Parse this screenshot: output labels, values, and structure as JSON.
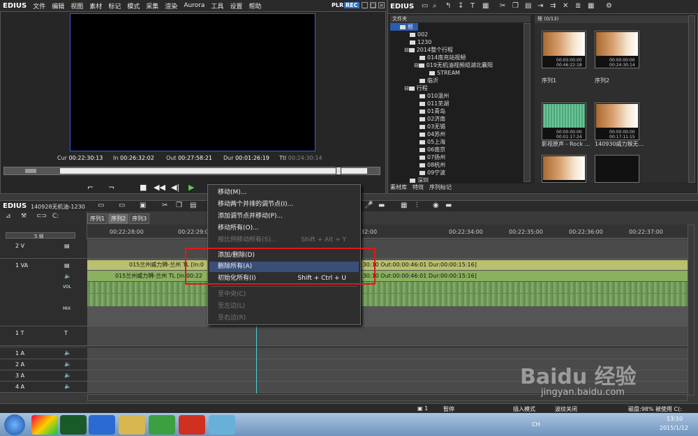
{
  "app": {
    "title": "EDIUS",
    "plr": "PLR",
    "rec": "REC"
  },
  "menubar": [
    "文件",
    "编辑",
    "视图",
    "素材",
    "标记",
    "模式",
    "采集",
    "渲染",
    "Aurora",
    "工具",
    "设置",
    "帮助"
  ],
  "player": {
    "cur_label": "Cur",
    "cur": "00:22:30:13",
    "in_label": "In",
    "in": "00:26:32:02",
    "out_label": "Out",
    "out": "00:27:58:21",
    "dur_label": "Dur",
    "dur": "00:01:26:19",
    "ttl_label": "Ttl",
    "ttl": "00:24:30:14"
  },
  "bin": {
    "title": "EDIUS",
    "folder_header": "文件夹",
    "root_label": "根",
    "clip_count": "根 (0/13)",
    "tree": [
      "根",
      "002",
      "1230",
      "2014整个行程",
      "014南充站视频",
      "019无机油视频组湖北襄阳",
      "STREAM",
      "临沂",
      "行程",
      "010温州",
      "011芜湖",
      "01青岛",
      "02济南",
      "03无锡",
      "04苏州",
      "05上海",
      "06南京",
      "07扬州",
      "08杭州",
      "09宁波",
      "深圳"
    ],
    "clips": [
      {
        "name": "序列1",
        "tc1": "00:00:00:00",
        "tc2": "00:46:22:18"
      },
      {
        "name": "序列2",
        "tc1": "00:00:00:00",
        "tc2": "00:24:30:14"
      },
      {
        "name": "影视原声 - Rock ...",
        "tc1": "00:00:00:00",
        "tc2": "00:01:17:24"
      },
      {
        "name": "140930威力猴无...",
        "tc1": "00:00:00:00",
        "tc2": "00:17:11:15"
      }
    ],
    "tabs": [
      "素材库",
      "特效",
      "序列标记"
    ]
  },
  "timeline": {
    "project": "140928无机油-1230",
    "zoom": "5 帧",
    "tabs": [
      "序列1",
      "序列2",
      "序列3"
    ],
    "ruler": [
      "00:22:28:00",
      "00:22:29:00",
      "32:00",
      "00:22:34:00",
      "00:22:35:00",
      "00:22:36:00",
      "00:22:37:00"
    ],
    "tracks": [
      "2 V",
      "1 VA",
      "1 T",
      "1 A",
      "2 A",
      "3 A",
      "4 A"
    ],
    "vol": "VOL",
    "mix": "MIX",
    "video_clip": "015兰州威力狮-兰州  TL [In:0",
    "video_clip_right": ":30:10 Out:00:00:46:01 Dur:00:00:15:16]",
    "audio_clip": "015兰州威力狮-兰州  TL [In:00:22",
    "audio_clip_right": ":30:10 Out:00:00:46:01 Dur:00:00:15:16]"
  },
  "context_menu": [
    {
      "label": "移动(M)...",
      "shortcut": "",
      "disabled": false
    },
    {
      "label": "移动两个并排的调节点(I)...",
      "shortcut": "",
      "disabled": false
    },
    {
      "label": "添加调节点并移动(P)...",
      "shortcut": "",
      "disabled": false
    },
    {
      "label": "移动所有(O)...",
      "shortcut": "",
      "disabled": false
    },
    {
      "label": "按比例移动所有(S)...",
      "shortcut": "Shift + Alt + Y",
      "disabled": true
    },
    {
      "label": "添加/删除(D)",
      "shortcut": "",
      "disabled": false
    },
    {
      "label": "删除所有(A)",
      "shortcut": "",
      "disabled": false
    },
    {
      "label": "初始化所有(I)",
      "shortcut": "Shift + Ctrl + U",
      "disabled": false
    },
    {
      "label": "至中央(C)",
      "shortcut": "",
      "disabled": true
    },
    {
      "label": "至左边(L)",
      "shortcut": "",
      "disabled": true
    },
    {
      "label": "至右边(R)",
      "shortcut": "",
      "disabled": true
    }
  ],
  "status": {
    "pause": "暂停",
    "insert_mode": "插入模式",
    "ripple_off": "波纹关闭",
    "disk": "磁盘:98% 被使用 C(:",
    "count": "1"
  },
  "taskbar": {
    "time": "13:10",
    "date": "2015/1/12",
    "lang": "CH"
  },
  "watermark": {
    "main": "Baidu 经验",
    "sub": "jingyan.baidu.com"
  }
}
